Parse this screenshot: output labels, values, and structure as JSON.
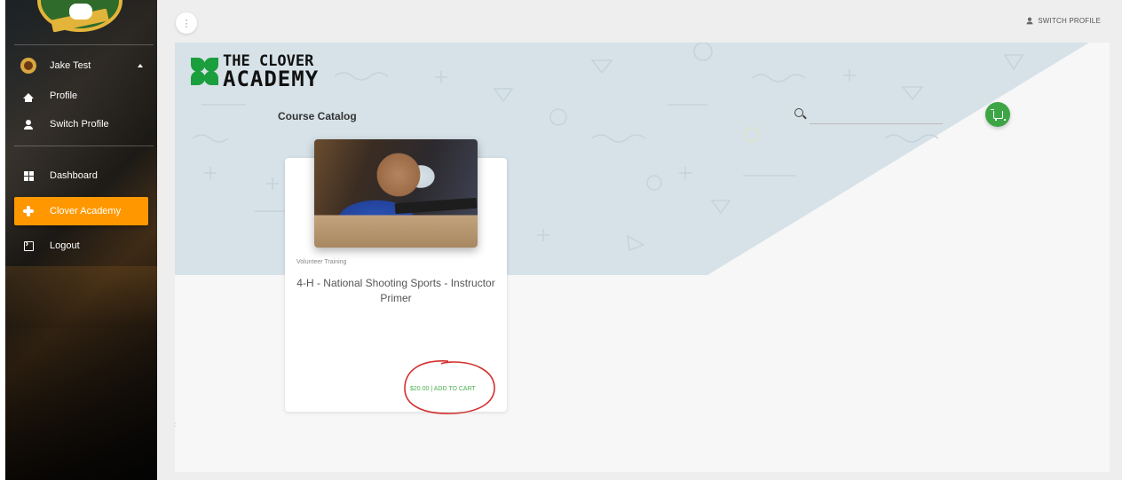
{
  "sidebar": {
    "user_name": "Jake Test",
    "items": [
      {
        "label": "Profile",
        "icon": "home-icon"
      },
      {
        "label": "Switch Profile",
        "icon": "person-icon"
      },
      {
        "label": "Dashboard",
        "icon": "dashboard-icon"
      },
      {
        "label": "Clover Academy",
        "icon": "clover-plus-icon"
      },
      {
        "label": "Logout",
        "icon": "logout-icon"
      }
    ],
    "active_color": "#ff9800"
  },
  "topbar": {
    "menu_glyph": "⋮",
    "switch_profile_label": "SWITCH PROFILE"
  },
  "brand": {
    "line1": "THE CLOVER",
    "line2": "ACADEMY",
    "color": "#1b9e3e"
  },
  "catalog": {
    "title": "Course Catalog",
    "search_value": "",
    "cart_color": "#3da546"
  },
  "course": {
    "category": "Volunteer Training",
    "title": "4-H - National Shooting Sports - Instructor Primer",
    "price_action": "$20.00 | ADD TO CART"
  },
  "annotation": {
    "color": "#d32f2f"
  }
}
